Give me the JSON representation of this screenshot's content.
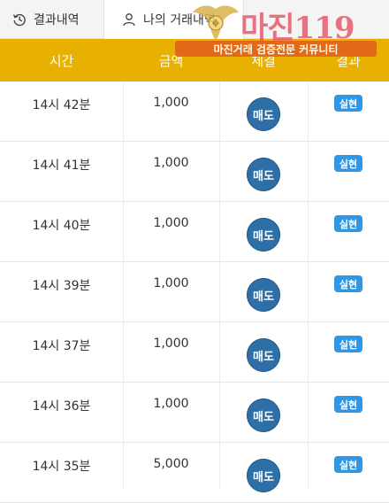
{
  "tabs": {
    "results": "결과내역",
    "mine": "나의 거래내역"
  },
  "table": {
    "headers": [
      "시간",
      "금액",
      "체결",
      "결과"
    ],
    "rows": [
      {
        "time": "14시 42분",
        "amount": "1,000",
        "action": "매도",
        "result": "실현"
      },
      {
        "time": "14시 41분",
        "amount": "1,000",
        "action": "매도",
        "result": "실현"
      },
      {
        "time": "14시 40분",
        "amount": "1,000",
        "action": "매도",
        "result": "실현"
      },
      {
        "time": "14시 39분",
        "amount": "1,000",
        "action": "매도",
        "result": "실현"
      },
      {
        "time": "14시 37분",
        "amount": "1,000",
        "action": "매도",
        "result": "실현"
      },
      {
        "time": "14시 36분",
        "amount": "1,000",
        "action": "매도",
        "result": "실현"
      },
      {
        "time": "14시 35분",
        "amount": "5,000",
        "action": "매도",
        "result": "실현"
      }
    ]
  },
  "watermark": {
    "brand": "마진119",
    "tagline": "마진거래 검증전문 커뮤니티"
  },
  "colors": {
    "header_bg": "#e8b000",
    "sell_button": "#2f6fa8",
    "result_badge": "#2f98e6",
    "watermark_tag": "#e2641a"
  },
  "icons": {
    "results_tab": "history-icon",
    "mine_tab": "user-icon"
  }
}
